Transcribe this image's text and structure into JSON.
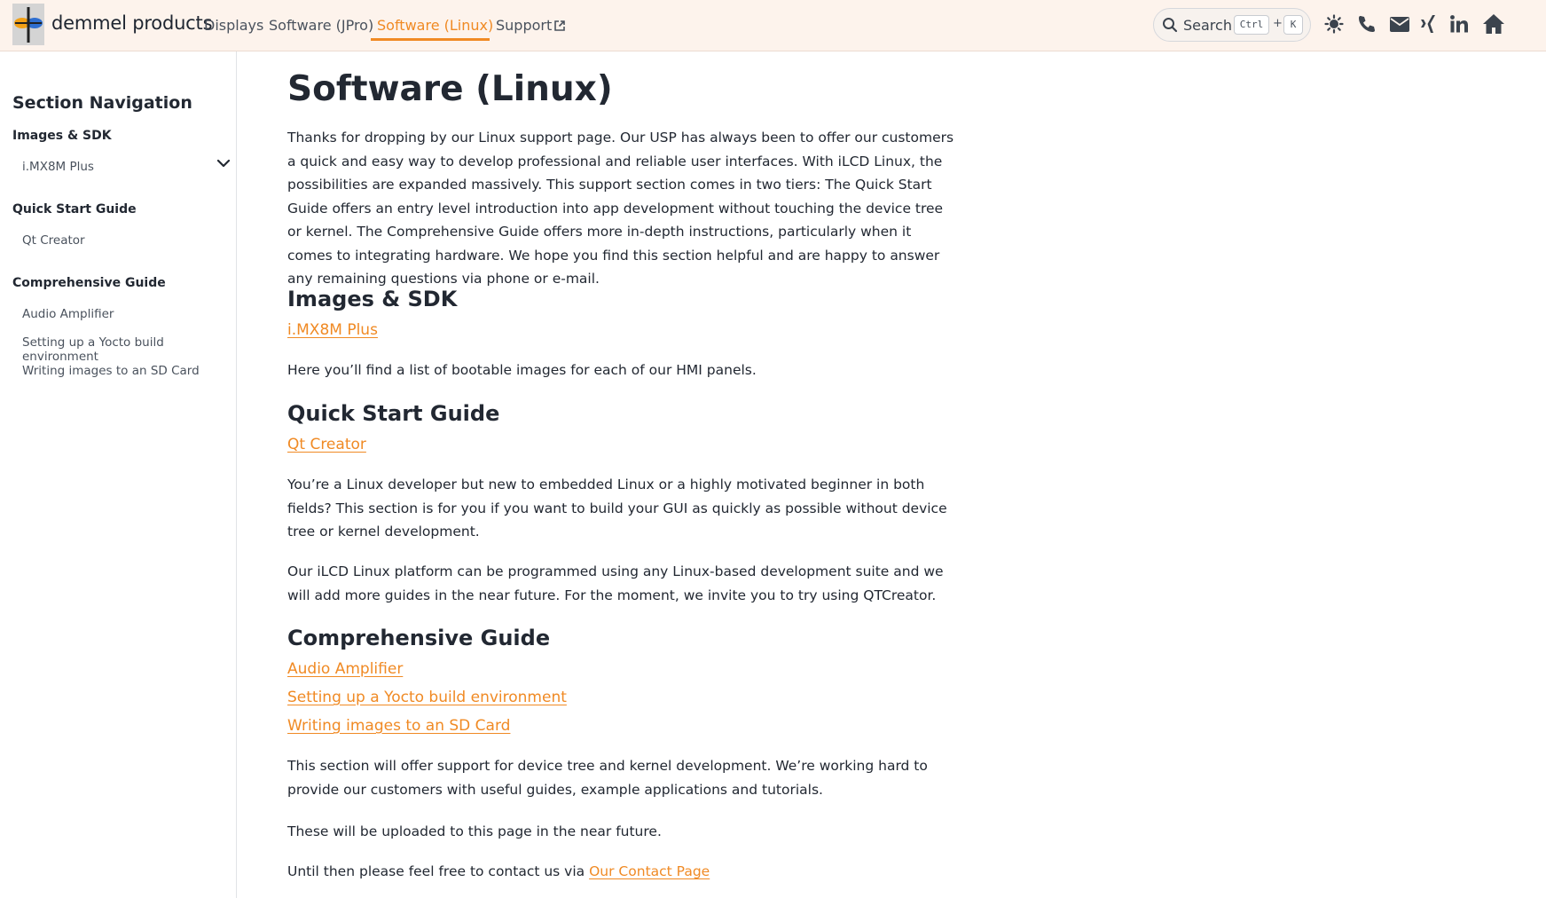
{
  "header": {
    "brand": "demmel products",
    "nav": [
      {
        "label": "Displays"
      },
      {
        "label": "Software (JPro)"
      },
      {
        "label": "Software (Linux)",
        "active": true
      },
      {
        "label": "Support"
      }
    ],
    "search": {
      "label": "Search",
      "shortcut": [
        "Ctrl",
        "+",
        "K"
      ]
    },
    "icons": [
      "theme-toggle-icon",
      "phone-icon",
      "envelope-icon",
      "xing-icon",
      "linkedin-icon",
      "home-icon"
    ],
    "accent_color": "#f08a24"
  },
  "sidebar": {
    "title": "Section Navigation",
    "groups": [
      {
        "label": "Images & SDK",
        "items": [
          {
            "label": "i.MX8M Plus",
            "expandable": true
          }
        ]
      },
      {
        "label": "Quick Start Guide",
        "items": [
          {
            "label": "Qt Creator"
          }
        ]
      },
      {
        "label": "Comprehensive Guide",
        "items": [
          {
            "label": "Audio Amplifier"
          },
          {
            "label": "Setting up a Yocto build environment"
          },
          {
            "label": "Writing images to an SD Card"
          }
        ]
      }
    ]
  },
  "main": {
    "title": "Software (Linux)",
    "intro": "Thanks for dropping by our Linux support page. Our USP has always been to offer our customers a quick and easy way to develop professional and reliable user interfaces. With iLCD Linux, the possibilities are expanded massively. This support section comes in two tiers: The Quick Start Guide offers an entry level introduction into app development without touching the device tree or kernel. The Comprehensive Guide offers more in-depth instructions, particularly when it comes to integrating hardware. We hope you find this section helpful and are happy to answer any remaining questions via phone or e-mail.",
    "sections": [
      {
        "heading": "Images & SDK",
        "links": [
          "i.MX8M Plus"
        ],
        "paragraphs": [
          "Here you’ll find a list of bootable images for each of our HMI panels."
        ]
      },
      {
        "heading": "Quick Start Guide",
        "links": [
          "Qt Creator"
        ],
        "paragraphs": [
          "You’re a Linux developer but new to embedded Linux or a highly motivated beginner in both fields? This section is for you if you want to build your GUI as quickly as possible without device tree or kernel development.",
          "Our iLCD Linux platform can be programmed using any Linux-based development suite and we will add more guides in the near future. For the moment, we invite you to try using QTCreator."
        ]
      },
      {
        "heading": "Comprehensive Guide",
        "links": [
          "Audio Amplifier",
          "Setting up a Yocto build environment",
          "Writing images to an SD Card"
        ],
        "paragraphs": [
          "This section will offer support for device tree and kernel development. We’re working hard to provide our customers with useful guides, example applications and tutorials.",
          "These will be uploaded to this page in the near future."
        ],
        "contact_text": "Until then please feel free to contact us via",
        "contact_link": "Our Contact Page"
      }
    ]
  }
}
